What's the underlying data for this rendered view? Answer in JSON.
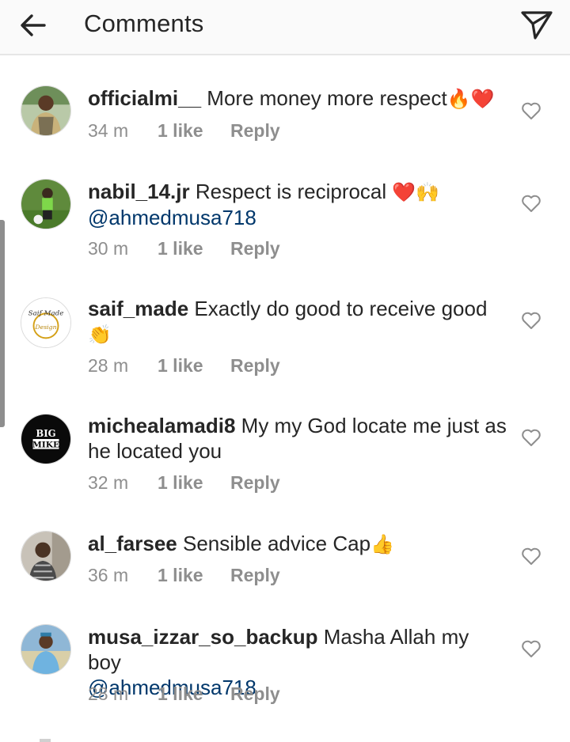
{
  "header": {
    "title": "Comments",
    "back_icon": "arrow-left-icon",
    "share_icon": "paper-plane-icon"
  },
  "comments": [
    {
      "username": "officialmi__",
      "text": "More money more respect",
      "emoji": "🔥❤️",
      "mention": "",
      "time": "34 m",
      "likes": "1 like",
      "reply": "Reply"
    },
    {
      "username": "nabil_14.jr",
      "text": "Respect is reciprocal",
      "emoji": "❤️🙌",
      "mention": "@ahmedmusa718",
      "time": "30 m",
      "likes": "1 like",
      "reply": "Reply"
    },
    {
      "username": "saif_made",
      "text": "Exactly do good to receive good",
      "emoji": "👏",
      "mention": "",
      "time": "28 m",
      "likes": "1 like",
      "reply": "Reply"
    },
    {
      "username": "michealamadi8",
      "text": "My my God locate me just as he located you",
      "emoji": "",
      "mention": "",
      "time": "32 m",
      "likes": "1 like",
      "reply": "Reply"
    },
    {
      "username": "al_farsee",
      "text": "Sensible advice Cap",
      "emoji": "👍",
      "mention": "",
      "time": "36 m",
      "likes": "1 like",
      "reply": "Reply"
    },
    {
      "username": "musa_izzar_so_backup",
      "text": "Masha Allah my boy",
      "emoji": "",
      "mention": "@ahmedmusa718",
      "time": "28 m",
      "likes": "1 like",
      "reply": "Reply"
    }
  ],
  "avatars": {
    "saif_made_logo_line1": "Saif Made",
    "saif_made_logo_line2": "Design",
    "michealamadi8_logo_line1": "BIG",
    "michealamadi8_logo_line2": "MIKE"
  },
  "colors": {
    "text": "#262626",
    "secondary": "#8e8e8e",
    "mention": "#00376b",
    "header_bg": "#fafafa"
  }
}
